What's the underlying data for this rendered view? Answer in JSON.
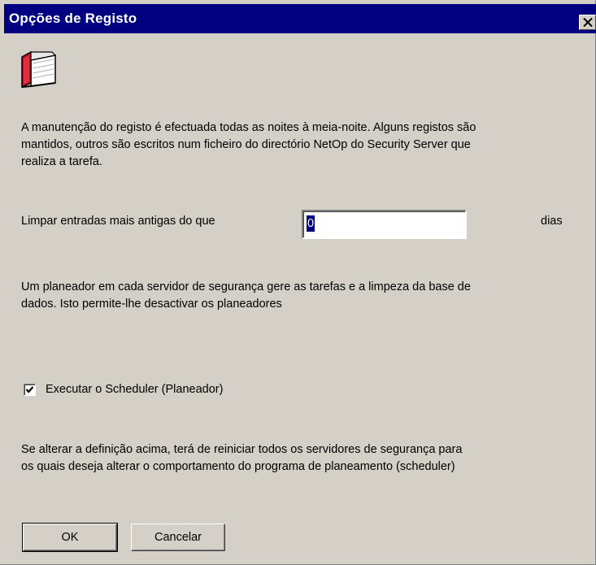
{
  "window": {
    "title": "Opções de Registo",
    "close_symbol": "✕",
    "icon": "book-icon"
  },
  "content": {
    "intro_line1": "A manutenção do registo é efectuada todas as noites à meia-noite. Alguns registos são",
    "intro_line2": "mantidos, outros são escritos num ficheiro do directório NetOp do Security Server que",
    "intro_line3": "realiza a tarefa.",
    "purge_label": "Limpar entradas mais antigas do que",
    "purge_days_value": "0",
    "days_unit": "dias",
    "scheduler_line1": "Um planeador em cada servidor de segurança gere as tarefas e a limpeza da base de",
    "scheduler_line2": "dados. Isto permite-lhe desactivar os planeadores",
    "run_scheduler_label": "Executar o Scheduler (Planeador)",
    "run_scheduler_checked": true,
    "note_line1": "Se alterar a definição acima, terá de reiniciar todos os servidores de segurança para",
    "note_line2": "os quais deseja alterar o comportamento do programa de planeamento (scheduler)"
  },
  "buttons": {
    "ok": "OK",
    "cancel": "Cancelar"
  },
  "colors": {
    "titlebar": "#000080",
    "face": "#d4d0c8",
    "book_cover": "#c0102a"
  }
}
